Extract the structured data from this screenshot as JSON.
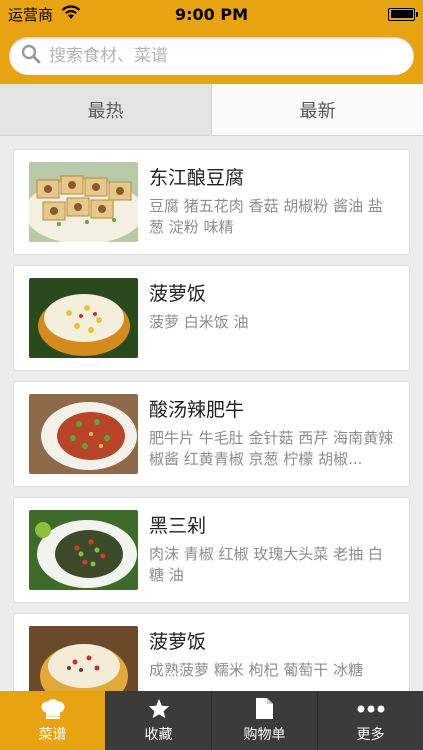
{
  "status_bar": {
    "carrier": "运营商",
    "time": "9:00 PM",
    "icons": [
      "wifi-icon",
      "battery-icon"
    ]
  },
  "search": {
    "placeholder": "搜索食材、菜谱",
    "value": ""
  },
  "tabs": [
    {
      "label": "最热",
      "active": true
    },
    {
      "label": "最新",
      "active": false
    }
  ],
  "recipes": [
    {
      "title": "东江酿豆腐",
      "ingredients": "豆腐 猪五花肉 香菇 胡椒粉 酱油 盐葱 淀粉 味精"
    },
    {
      "title": "菠萝饭",
      "ingredients": "菠萝 白米饭 油"
    },
    {
      "title": "酸汤辣肥牛",
      "ingredients": "肥牛片 牛毛肚 金针菇 西芹 海南黄辣椒酱 红黄青椒 京葱 柠檬 胡椒..."
    },
    {
      "title": "黑三剁",
      "ingredients": "肉沫 青椒 红椒 玫瑰大头菜 老抽 白糖 油"
    },
    {
      "title": "菠萝饭",
      "ingredients": "成熟菠萝 糯米 枸杞 葡萄干 冰糖"
    }
  ],
  "tab_bar": [
    {
      "label": "菜谱",
      "icon": "chef-hat-icon",
      "active": true
    },
    {
      "label": "收藏",
      "icon": "star-icon",
      "active": false
    },
    {
      "label": "购物单",
      "icon": "document-icon",
      "active": false
    },
    {
      "label": "更多",
      "icon": "more-dots-icon",
      "active": false
    }
  ],
  "colors": {
    "accent": "#e8a312",
    "tab_bar_bg": "#3b3b3b"
  }
}
